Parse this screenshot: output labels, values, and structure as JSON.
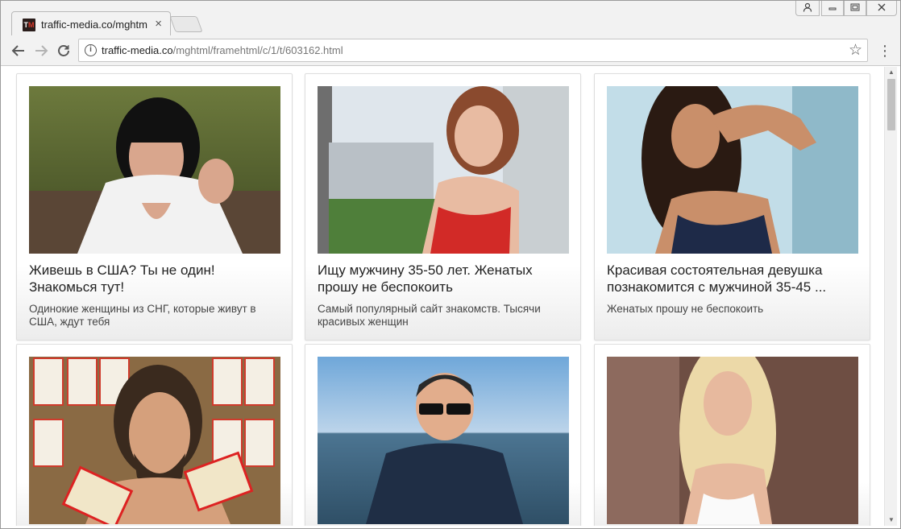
{
  "browser": {
    "tab_title": "traffic-media.co/mghtml/",
    "favicon_text": "TM",
    "url_host": "traffic-media.co",
    "url_path": "/mghtml/framehtml/c/1/t/603162.html",
    "tab_close": "×",
    "icons": {
      "back": "←",
      "forward": "→",
      "reload": "↻",
      "info": "i",
      "star": "☆",
      "menu": "⋮",
      "user": "👤",
      "minimize": "▭",
      "maximize": "❐",
      "close": "✕"
    }
  },
  "cards": [
    {
      "title": "Живешь в США? Ты не один! Знакомься тут!",
      "desc": "Одинокие женщины из СНГ, которые живут в США, ждут тебя",
      "image": "woman-black-hair-photo"
    },
    {
      "title": "Ищу мужчину 35-50 лет. Женатых прошу не беспокоить",
      "desc": "Самый популярный сайт знакомств. Тысячи красивых женщин",
      "image": "woman-red-top-photo"
    },
    {
      "title": "Красивая состоятельная девушка познакомится с мужчиной 35-45 ...",
      "desc": "Женатых прошу не беспокоить",
      "image": "woman-dark-top-photo"
    },
    {
      "title": "",
      "desc": "",
      "image": "man-holding-soda-box-photo"
    },
    {
      "title": "",
      "desc": "",
      "image": "man-sunglasses-sea-photo"
    },
    {
      "title": "",
      "desc": "",
      "image": "blonde-woman-photo"
    }
  ],
  "colors": {
    "chrome_bg": "#f2f2f2",
    "card_border": "#dddddd",
    "text_primary": "#222222"
  }
}
